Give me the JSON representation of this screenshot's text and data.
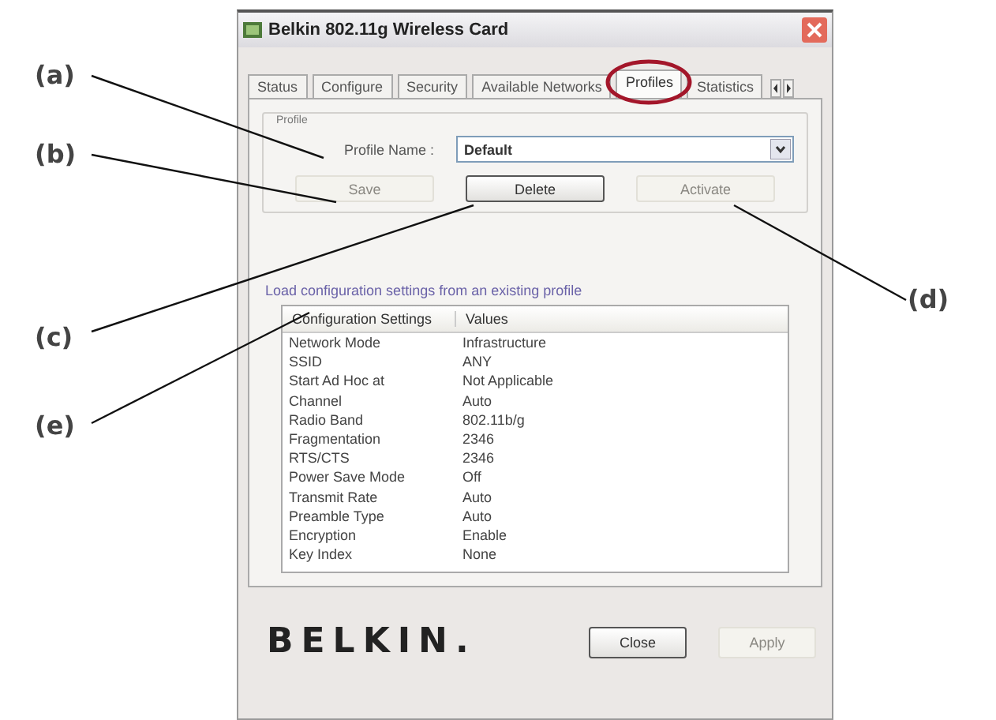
{
  "callouts": [
    {
      "label": "(a)"
    },
    {
      "label": "(b)"
    },
    {
      "label": "(c)"
    },
    {
      "label": "(d)"
    },
    {
      "label": "(e)"
    }
  ],
  "window": {
    "title": "Belkin 802.11g Wireless Card"
  },
  "tabs": [
    {
      "label": "Status",
      "selected": false
    },
    {
      "label": "Configure",
      "selected": false
    },
    {
      "label": "Security",
      "selected": false
    },
    {
      "label": "Available Networks",
      "selected": false
    },
    {
      "label": "Profiles",
      "selected": true
    },
    {
      "label": "Statistics",
      "selected": false
    }
  ],
  "profile": {
    "group_label": "Profile",
    "name_label": "Profile Name :",
    "name_value": "Default"
  },
  "buttons": [
    {
      "label": "Save",
      "disabled": true
    },
    {
      "label": "Delete",
      "disabled": false
    },
    {
      "label": "Activate",
      "disabled": true
    }
  ],
  "hint": "Load configuration settings from an existing profile",
  "table": {
    "columns": [
      "Configuration Settings",
      "Values"
    ],
    "rows": [
      [
        "Network Mode",
        "Infrastructure"
      ],
      [
        "SSID",
        "ANY"
      ],
      [
        "Start Ad Hoc at",
        "Not Applicable"
      ],
      [
        "Channel",
        "Auto"
      ],
      [
        "Radio Band",
        "802.11b/g"
      ],
      [
        "Fragmentation",
        "2346"
      ],
      [
        "RTS/CTS",
        "2346"
      ],
      [
        "Power Save Mode",
        "Off"
      ],
      [
        "Transmit Rate",
        "Auto"
      ],
      [
        "Preamble Type",
        "Auto"
      ],
      [
        "Encryption",
        "Enable"
      ],
      [
        "Key Index",
        "None"
      ]
    ]
  },
  "logo": "BELKIN.",
  "footer_buttons": [
    {
      "label": "Close",
      "disabled": false
    },
    {
      "label": "Apply",
      "disabled": true
    }
  ]
}
